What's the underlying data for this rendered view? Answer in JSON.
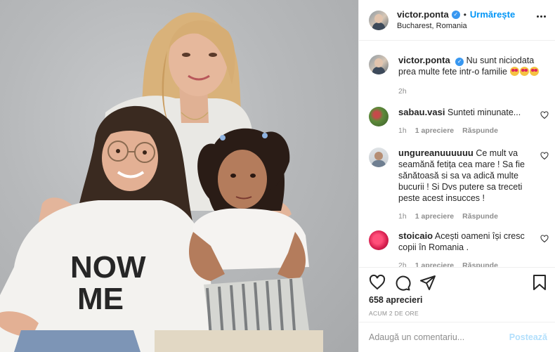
{
  "header": {
    "username": "victor.ponta",
    "verified_icon": "verified-badge-icon",
    "separator": "•",
    "follow_label": "Urmărește",
    "location": "Bucharest, Romania"
  },
  "caption": {
    "username": "victor.ponta",
    "text": "Nu sunt niciodata prea multe fete intr-o familie",
    "emojis": [
      "smiling-face-with-heart-eyes",
      "smiling-face-with-heart-eyes",
      "smiling-face-with-heart-eyes"
    ],
    "time": "2h"
  },
  "comments": [
    {
      "username": "sabau.vasi",
      "text": "Sunteti minunate...",
      "time": "1h",
      "likes": "1 apreciere",
      "reply": "Răspunde"
    },
    {
      "username": "ungureanuuuuuu",
      "text": "Ce mult va seamănă fetița cea mare ! Sa fie sănătoasă si sa va adică multe bucurii ! Si Dvs putere sa treceti peste acest insucces !",
      "time": "1h",
      "likes": "1 apreciere",
      "reply": "Răspunde"
    },
    {
      "username": "stoicaio",
      "text": "Acești oameni își cresc copii în Romania .",
      "time": "2h",
      "likes": "1 apreciere",
      "reply": "Răspunde"
    }
  ],
  "actions": {
    "likes": "658 aprecieri",
    "time_ago": "ACUM 2 DE ORE",
    "icons": [
      "heart-icon",
      "comment-icon",
      "share-icon",
      "bookmark-icon"
    ]
  },
  "add_comment": {
    "placeholder": "Adaugă un comentariu...",
    "post_label": "Postează"
  },
  "photo": {
    "shirt_text_line1": "NOW",
    "shirt_text_line2": "ME"
  },
  "colors": {
    "accent": "#0095f6",
    "post_disabled": "#b2dffc",
    "muted": "#8e8e8e",
    "text": "#262626"
  }
}
